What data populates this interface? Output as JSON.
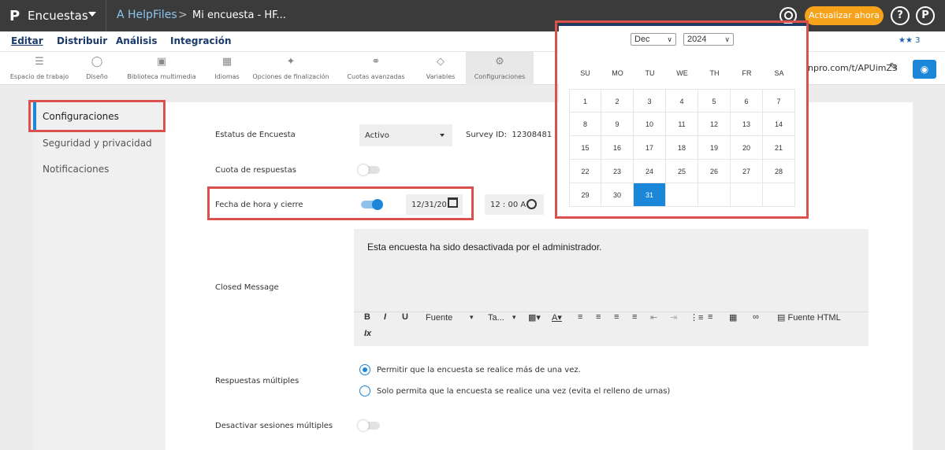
{
  "topbar": {
    "logo": "P",
    "product": "Encuestas",
    "folder": "A HelpFiles",
    "separator": ">",
    "survey_name": "Mi encuesta - HF...",
    "upgrade_label": "Actualizar ahora",
    "help_label": "?",
    "profile_label": "P"
  },
  "menu": {
    "tabs": [
      "Editar",
      "Distribuir",
      "Análisis",
      "Integración"
    ],
    "collaborators_count": "3"
  },
  "toolbar": {
    "items": [
      "Espacio de trabajo",
      "Diseño",
      "Biblioteca multimedia",
      "Idiomas",
      "Opciones de finalización",
      "Cuotas avanzadas",
      "Variables",
      "Configuraciones"
    ],
    "url_text": "npro.com/t/APUimZ3"
  },
  "sidebar": {
    "items": [
      "Configuraciones",
      "Seguridad y privacidad",
      "Notificaciones"
    ]
  },
  "settings": {
    "status_label": "Estatus de Encuesta",
    "status_value": "Activo",
    "survey_id_label": "Survey ID:",
    "survey_id": "12308481",
    "quota_label": "Cuota de respuestas",
    "close_date_label": "Fecha de hora y cierre",
    "close_date_value": "12/31/20",
    "close_time_value": "12 : 00 A",
    "closed_message_label": "Closed Message",
    "closed_message_text": "Esta encuesta ha sido desactivada por el administrador.",
    "editor": {
      "bold": "B",
      "italic": "I",
      "underline": "U",
      "font": "Fuente",
      "size": "Ta...",
      "html_source": "Fuente HTML",
      "clear_format": "Ix"
    },
    "multiple_responses_label": "Respuestas múltiples",
    "option_allow": "Permitir que la encuesta se realice más de una vez.",
    "option_once": "Solo permita que la encuesta se realice una vez (evita el relleno de urnas)",
    "disable_sessions_label": "Desactivar sesiones múltiples"
  },
  "calendar": {
    "month": "Dec",
    "year": "2024",
    "weekdays": [
      "SU",
      "MO",
      "TU",
      "WE",
      "TH",
      "FR",
      "SA"
    ],
    "days": [
      "1",
      "2",
      "3",
      "4",
      "5",
      "6",
      "7",
      "8",
      "9",
      "10",
      "11",
      "12",
      "13",
      "14",
      "15",
      "16",
      "17",
      "18",
      "19",
      "20",
      "21",
      "22",
      "23",
      "24",
      "25",
      "26",
      "27",
      "28",
      "29",
      "30",
      "31"
    ],
    "selected": "31"
  },
  "colors": {
    "accent": "#1c86d8",
    "highlight": "#d9524e",
    "upgrade": "#f7a21b",
    "topbar": "#3b3b3b"
  }
}
